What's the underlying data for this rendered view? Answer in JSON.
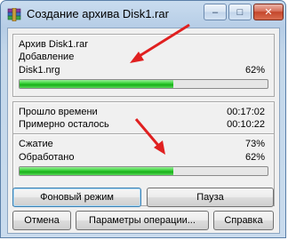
{
  "window": {
    "title": "Создание архива Disk1.rar",
    "controls": {
      "minimize": "–",
      "maximize": "□",
      "close": "✕"
    }
  },
  "archive": {
    "name_line": "Архив Disk1.rar",
    "action": "Добавление",
    "current_file": "Disk1.nrg",
    "file_percent": "62%",
    "file_progress": 0.62
  },
  "stats": {
    "elapsed_label": "Прошло времени",
    "elapsed_value": "00:17:02",
    "remaining_label": "Примерно осталось",
    "remaining_value": "00:10:22",
    "ratio_label": "Сжатие",
    "ratio_value": "73%",
    "processed_label": "Обработано",
    "processed_value": "62%",
    "total_progress": 0.62
  },
  "buttons": {
    "background": "Фоновый режим",
    "pause": "Пауза",
    "cancel": "Отмена",
    "options": "Параметры операции...",
    "help": "Справка"
  },
  "colors": {
    "progress_green": "#18b018",
    "annotation_arrow": "#e02020"
  }
}
